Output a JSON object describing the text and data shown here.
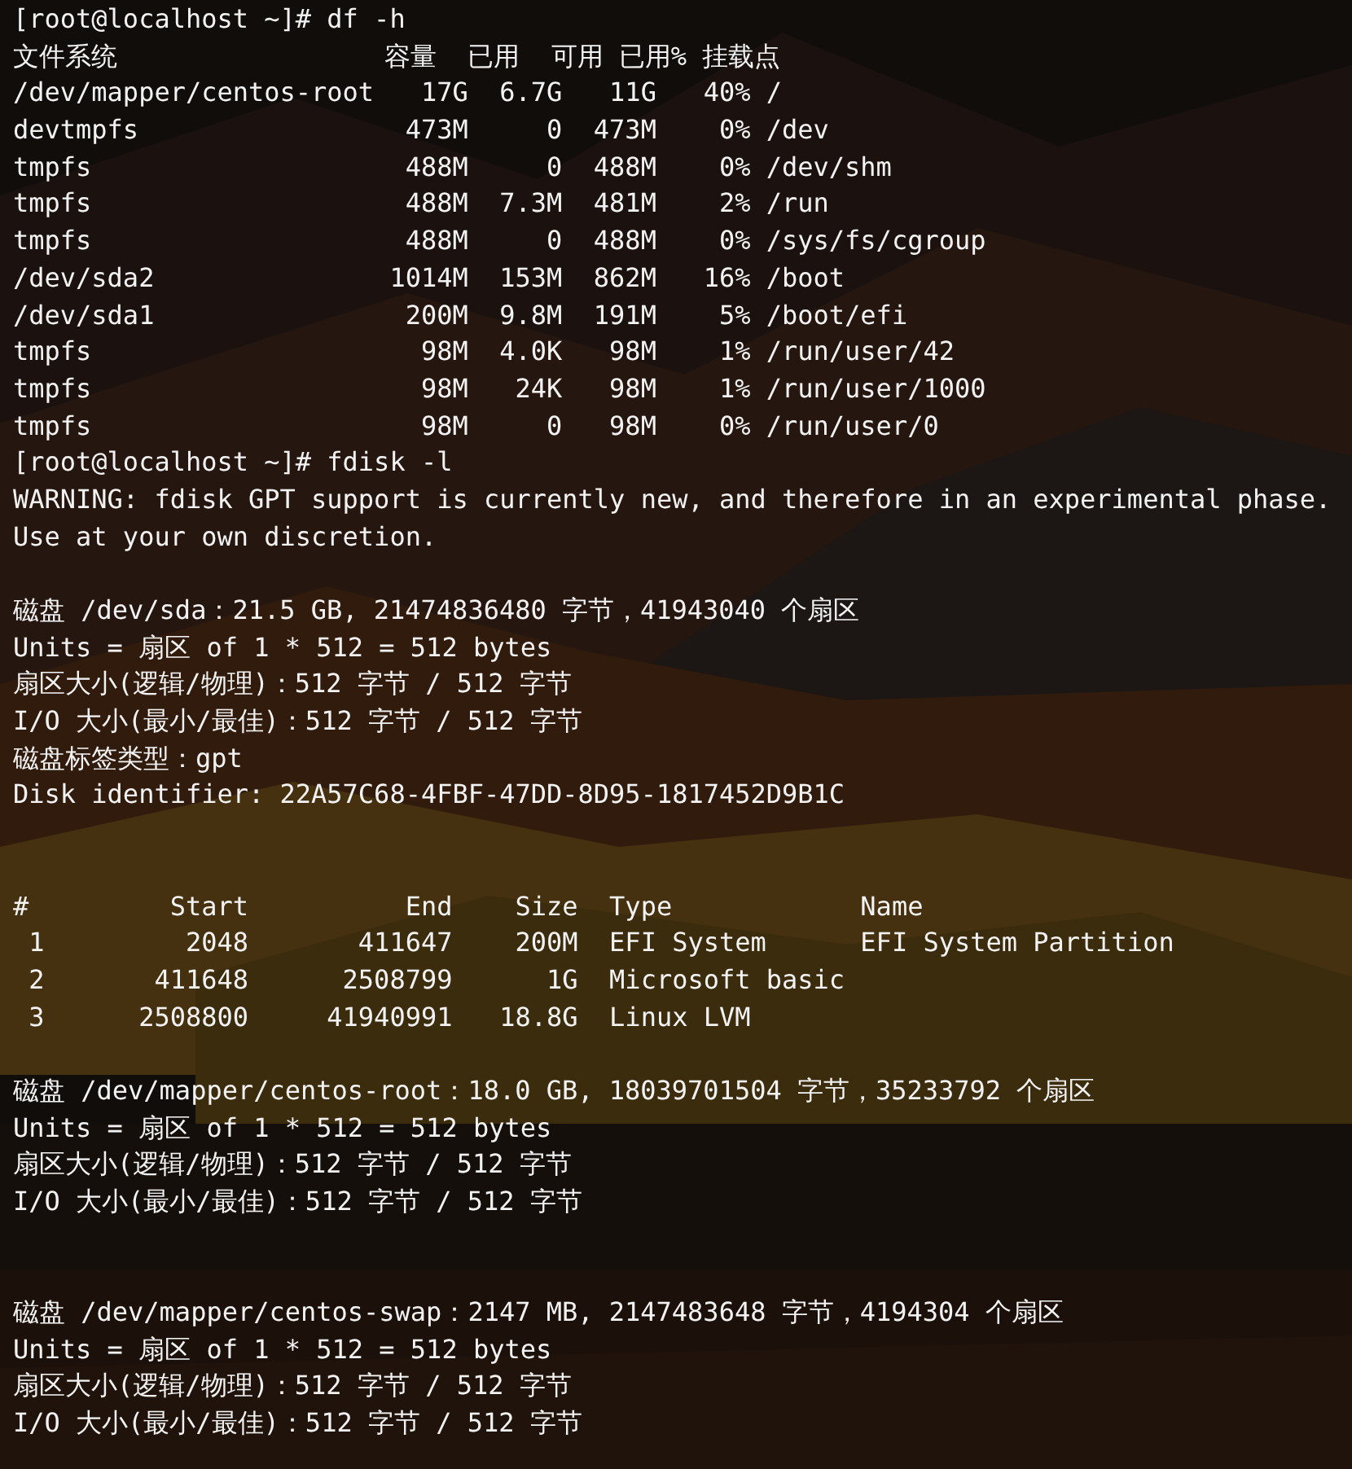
{
  "terminal": {
    "blocks": [
      {
        "lines": [
          "[root@localhost ~]# df -h",
          "文件系统                 容量  已用  可用 已用% 挂载点",
          "/dev/mapper/centos-root   17G  6.7G   11G   40% /",
          "devtmpfs                 473M     0  473M    0% /dev",
          "tmpfs                    488M     0  488M    0% /dev/shm",
          "tmpfs                    488M  7.3M  481M    2% /run",
          "tmpfs                    488M     0  488M    0% /sys/fs/cgroup",
          "/dev/sda2               1014M  153M  862M   16% /boot",
          "/dev/sda1                200M  9.8M  191M    5% /boot/efi",
          "tmpfs                     98M  4.0K   98M    1% /run/user/42",
          "tmpfs                     98M   24K   98M    1% /run/user/1000",
          "tmpfs                     98M     0   98M    0% /run/user/0",
          "[root@localhost ~]# fdisk -l",
          "WARNING: fdisk GPT support is currently new, and therefore in an experimental phase.",
          "Use at your own discretion."
        ]
      },
      {
        "lines": [
          "磁盘 /dev/sda：21.5 GB, 21474836480 字节，41943040 个扇区",
          "Units = 扇区 of 1 * 512 = 512 bytes",
          "扇区大小(逻辑/物理)：512 字节 / 512 字节",
          "I/O 大小(最小/最佳)：512 字节 / 512 字节",
          "磁盘标签类型：gpt",
          "Disk identifier: 22A57C68-4FBF-47DD-8D95-1817452D9B1C"
        ]
      },
      {
        "lines": [
          "#         Start          End    Size  Type            Name",
          " 1         2048       411647    200M  EFI System      EFI System Partition",
          " 2       411648      2508799      1G  Microsoft basic",
          " 3      2508800     41940991   18.8G  Linux LVM"
        ]
      },
      {
        "lines": [
          "磁盘 /dev/mapper/centos-root：18.0 GB, 18039701504 字节，35233792 个扇区",
          "Units = 扇区 of 1 * 512 = 512 bytes",
          "扇区大小(逻辑/物理)：512 字节 / 512 字节",
          "I/O 大小(最小/最佳)：512 字节 / 512 字节"
        ]
      },
      {
        "lines": [
          "磁盘 /dev/mapper/centos-swap：2147 MB, 2147483648 字节，4194304 个扇区",
          "Units = 扇区 of 1 * 512 = 512 bytes",
          "扇区大小(逻辑/物理)：512 字节 / 512 字节",
          "I/O 大小(最小/最佳)：512 字节 / 512 字节"
        ]
      }
    ]
  }
}
